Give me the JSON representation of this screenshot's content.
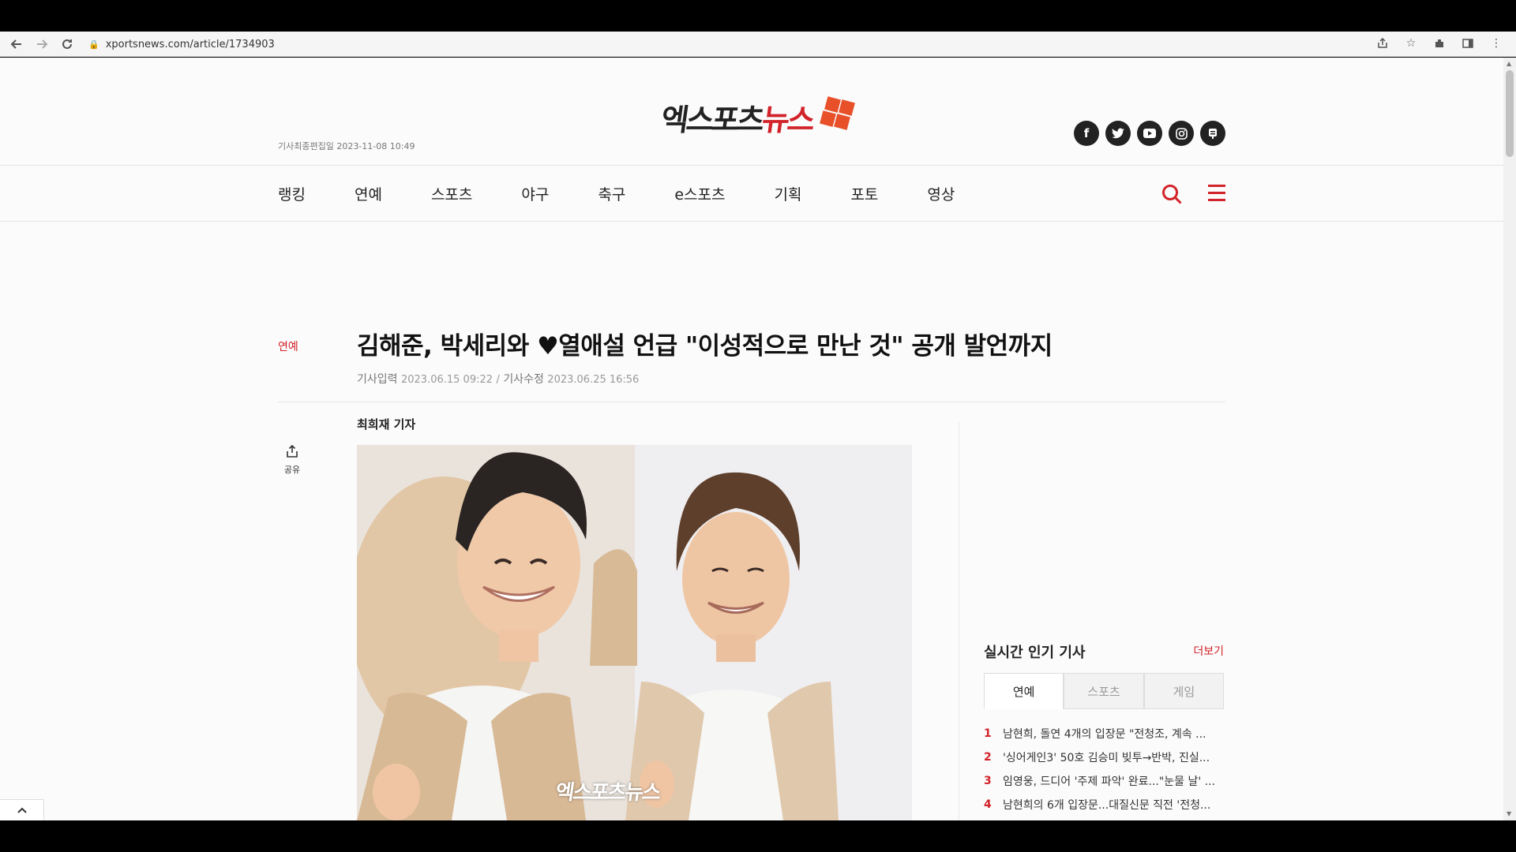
{
  "browser": {
    "url": "xportsnews.com/article/1734903",
    "icons": [
      "back-icon",
      "forward-icon",
      "reload-icon",
      "lock-icon",
      "share-icon",
      "star-icon",
      "extension-icon",
      "sidepanel-icon",
      "kebab-menu-icon"
    ]
  },
  "header": {
    "last_edit": "기사최종편집일 2023-11-08 10:49",
    "logo_black": "엑스포츠",
    "logo_red": "뉴스",
    "social": [
      "facebook-icon",
      "twitter-icon",
      "youtube-icon",
      "instagram-icon",
      "post-icon"
    ]
  },
  "menu": {
    "items": [
      "랭킹",
      "연예",
      "스포츠",
      "야구",
      "축구",
      "e스포츠",
      "기획",
      "포토",
      "영상"
    ]
  },
  "article": {
    "category": "연예",
    "title": "김해준, 박세리와 ♥열애설 언급 \"이성적으로 만난 것\" 공개 발언까지",
    "input_label": "기사입력",
    "input_date": "2023.06.15 09:22",
    "sep": "/",
    "modified_label": "기사수정",
    "modified_date": "2023.06.25 16:56",
    "reporter": "최희재 기자",
    "share_label": "공유",
    "watermark": "엑스포츠뉴스"
  },
  "popular": {
    "title": "실시간 인기 기사",
    "more": "더보기",
    "tabs": [
      "연예",
      "스포츠",
      "게임"
    ],
    "active_tab": "연예",
    "items": [
      {
        "rank": "1",
        "text": "남현희, 돌연 4개의 입장문 \"전청조, 계속 ..."
      },
      {
        "rank": "2",
        "text": "'싱어게인3' 50호 김승미 빚투→반박, 진실..."
      },
      {
        "rank": "3",
        "text": "임영웅, 드디어 '주제 파악' 완료...\"눈물 날' ..."
      },
      {
        "rank": "4",
        "text": "남현희의 6개 입장문...대질신문 직전 '전청..."
      }
    ]
  },
  "colors": {
    "brand_red": "#d2232a",
    "logo_orange": "#e8502a"
  }
}
